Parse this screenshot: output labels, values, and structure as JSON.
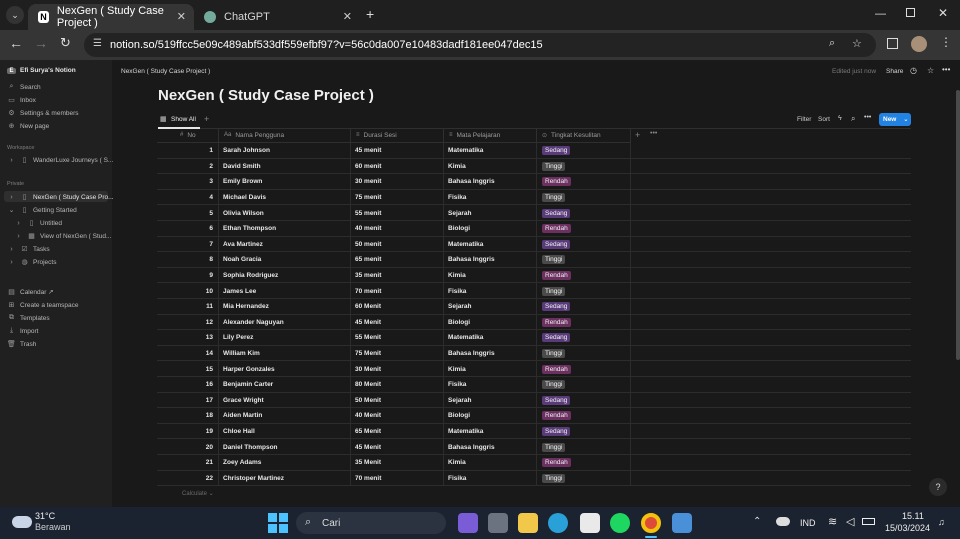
{
  "browser": {
    "tabs": [
      {
        "label": "NexGen ( Study Case Project )",
        "active": true,
        "favicon": "notion-icon"
      },
      {
        "label": "ChatGPT",
        "active": false,
        "favicon": "chatgpt-icon"
      }
    ],
    "new_tab": "+",
    "url": "notion.so/519ffcc5e09c489abf533df559efbf97?v=56c0da007e10483dadf181ee047dec15"
  },
  "sidebar": {
    "workspace_name": "Efi Surya's Notion",
    "top_items": [
      {
        "label": "Search",
        "icon": "search-icon"
      },
      {
        "label": "Inbox",
        "icon": "inbox-icon"
      },
      {
        "label": "Settings & members",
        "icon": "gear-icon"
      },
      {
        "label": "New page",
        "icon": "plus-circle-icon"
      }
    ],
    "workspace_section": "Workspace",
    "workspace_items": [
      {
        "label": "WanderLuxe Journeys ( S..."
      }
    ],
    "private_section": "Private",
    "private_items": [
      {
        "label": "NexGen ( Study Case Pro..."
      },
      {
        "label": "Getting Started"
      },
      {
        "label": "Untitled"
      },
      {
        "label": "View of NexGen ( Stud..."
      },
      {
        "label": "Tasks"
      },
      {
        "label": "Projects"
      }
    ],
    "bottom_items": [
      {
        "label": "Calendar ↗"
      },
      {
        "label": "Create a teamspace"
      },
      {
        "label": "Templates"
      },
      {
        "label": "Import"
      },
      {
        "label": "Trash"
      }
    ]
  },
  "topbar": {
    "breadcrumb": "NexGen ( Study Case Project )",
    "edited": "Edited just now",
    "share": "Share"
  },
  "page": {
    "title": "NexGen ( Study Case Project )",
    "view_tab": "Show All",
    "filter": "Filter",
    "sort": "Sort",
    "new_button": "New",
    "calculate": "Calculate"
  },
  "table": {
    "columns": [
      "No",
      "Nama Pengguna",
      "Durasi Sesi",
      "Mata Pelajaran",
      "Tingkat Kesulitan"
    ],
    "rows": [
      [
        "1",
        "Sarah Johnson",
        "45 menit",
        "Matematika",
        "Sedang"
      ],
      [
        "2",
        "David Smith",
        "60 menit",
        "Kimia",
        "Tinggi"
      ],
      [
        "3",
        "Emily Brown",
        "30 menit",
        "Bahasa Inggris",
        "Rendah"
      ],
      [
        "4",
        "Michael Davis",
        "75 menit",
        "Fisika",
        "Tinggi"
      ],
      [
        "5",
        "Olivia Wilson",
        "55 menit",
        "Sejarah",
        "Sedang"
      ],
      [
        "6",
        "Ethan Thompson",
        "40 menit",
        "Biologi",
        "Rendah"
      ],
      [
        "7",
        "Ava Martinez",
        "50 menit",
        "Matematika",
        "Sedang"
      ],
      [
        "8",
        "Noah Gracia",
        "65 menit",
        "Bahasa Inggris",
        "Tinggi"
      ],
      [
        "9",
        "Sophia Rodriguez",
        "35 menit",
        "Kimia",
        "Rendah"
      ],
      [
        "10",
        "James Lee",
        "70 menit",
        "Fisika",
        "Tinggi"
      ],
      [
        "11",
        "Mia Hernandez",
        "60 Menit",
        "Sejarah",
        "Sedang"
      ],
      [
        "12",
        "Alexander Naguyan",
        "45 Menit",
        "Biologi",
        "Rendah"
      ],
      [
        "13",
        "Lily Perez",
        "55 Menit",
        "Matematika",
        "Sedang"
      ],
      [
        "14",
        "William Kim",
        "75 Menit",
        "Bahasa Inggris",
        "Tinggi"
      ],
      [
        "15",
        "Harper Gonzales",
        "30 Menit",
        "Kimia",
        "Rendah"
      ],
      [
        "16",
        "Benjamin Carter",
        "80 Menit",
        "Fisika",
        "Tinggi"
      ],
      [
        "17",
        "Grace Wright",
        "50 Menit",
        "Sejarah",
        "Sedang"
      ],
      [
        "18",
        "Aiden Martin",
        "40 Menit",
        "Biologi",
        "Rendah"
      ],
      [
        "19",
        "Chloe Hall",
        "65 Menit",
        "Matematika",
        "Sedang"
      ],
      [
        "20",
        "Daniel Thompson",
        "45 Menit",
        "Bahasa Inggris",
        "Tinggi"
      ],
      [
        "21",
        "Zoey Adams",
        "35 Menit",
        "Kimia",
        "Rendah"
      ],
      [
        "22",
        "Christoper Martinez",
        "70 menit",
        "Fisika",
        "Tinggi"
      ]
    ],
    "tag_colors": {
      "Sedang": "#5a3b7a",
      "Tinggi": "#4a4a4a",
      "Rendah": "#6b2f60"
    }
  },
  "taskbar": {
    "weather_temp": "31°C",
    "weather_desc": "Berawan",
    "search_placeholder": "Cari",
    "language": "IND",
    "time": "15.11",
    "date": "15/03/2024"
  }
}
